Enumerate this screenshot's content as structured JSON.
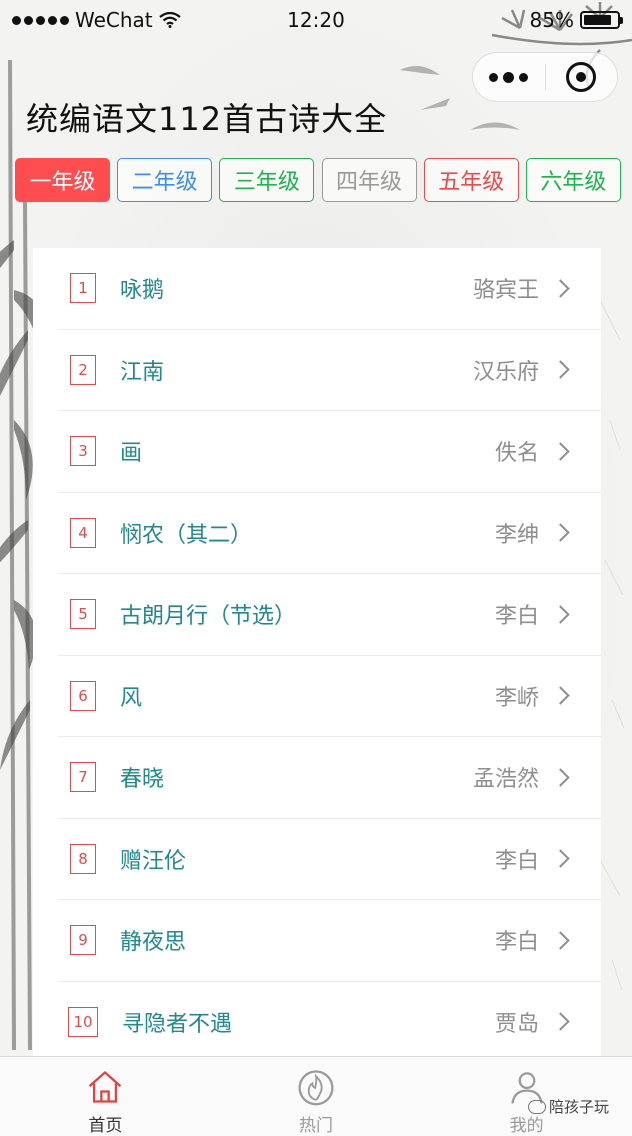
{
  "status_bar": {
    "carrier": "WeChat",
    "time": "12:20",
    "battery": "85%",
    "battery_level": 0.85
  },
  "page": {
    "title": "统编语文112首古诗大全"
  },
  "grades": [
    {
      "label": "一年级",
      "color": "#ff4d4f",
      "active": true
    },
    {
      "label": "二年级",
      "color": "#3d8ef0",
      "active": false
    },
    {
      "label": "三年级",
      "color": "#1cb64b",
      "active": false
    },
    {
      "label": "四年级",
      "color": "#9a9a9a",
      "active": false
    },
    {
      "label": "五年级",
      "color": "#f04848",
      "active": false
    },
    {
      "label": "六年级",
      "color": "#1cb64b",
      "active": false
    }
  ],
  "poems": [
    {
      "num": "1",
      "title": "咏鹅",
      "author": "骆宾王"
    },
    {
      "num": "2",
      "title": "江南",
      "author": "汉乐府"
    },
    {
      "num": "3",
      "title": "画",
      "author": "佚名"
    },
    {
      "num": "4",
      "title": "悯农（其二）",
      "author": "李绅"
    },
    {
      "num": "5",
      "title": "古朗月行（节选）",
      "author": "李白"
    },
    {
      "num": "6",
      "title": "风",
      "author": "李峤"
    },
    {
      "num": "7",
      "title": "春晓",
      "author": "孟浩然"
    },
    {
      "num": "8",
      "title": "赠汪伦",
      "author": "李白"
    },
    {
      "num": "9",
      "title": "静夜思",
      "author": "李白"
    },
    {
      "num": "10",
      "title": "寻隐者不遇",
      "author": "贾岛"
    }
  ],
  "tab_bar": {
    "items": [
      {
        "label": "首页",
        "icon": "home-icon",
        "active": true
      },
      {
        "label": "热门",
        "icon": "fire-icon",
        "active": false
      },
      {
        "label": "我的",
        "icon": "user-icon",
        "active": false
      }
    ]
  },
  "watermark": {
    "text": "陪孩子玩"
  },
  "colors": {
    "accent_red": "#ff4d4f",
    "poem_title": "#1e8a8f",
    "number_red": "#e24b4b"
  }
}
